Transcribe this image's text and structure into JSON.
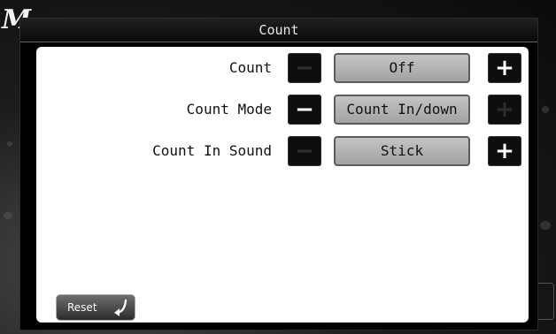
{
  "background": {
    "logo_glyph": "M"
  },
  "dialog": {
    "title": "Count"
  },
  "rows": [
    {
      "label": "Count",
      "value": "Off",
      "minus_enabled": false,
      "plus_enabled": true
    },
    {
      "label": "Count Mode",
      "value": "Count In/down",
      "minus_enabled": true,
      "plus_enabled": false
    },
    {
      "label": "Count In Sound",
      "value": "Stick",
      "minus_enabled": false,
      "plus_enabled": true
    }
  ],
  "stepper": {
    "minus_glyph": "−",
    "plus_glyph": "+"
  },
  "footer": {
    "reset_label": "Reset",
    "reset_icon": "return-arrow-icon"
  }
}
